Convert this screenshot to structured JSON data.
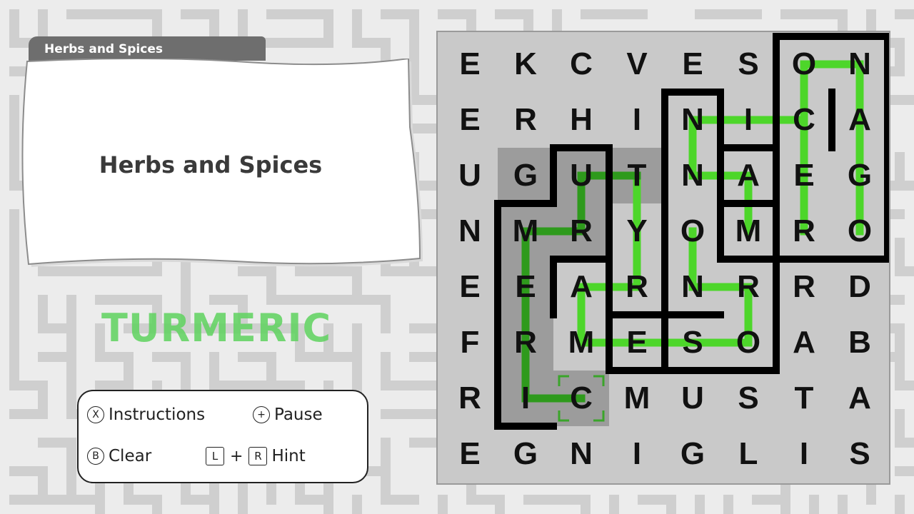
{
  "category_tab": "Herbs and Spices",
  "category_title": "Herbs and Spices",
  "found_word": "TURMERIC",
  "controls": {
    "instructions_button": "X",
    "instructions": "Instructions",
    "pause_button": "+",
    "pause": "Pause",
    "clear_button": "B",
    "clear": "Clear",
    "hint_key_l": "L",
    "hint_plus": "+",
    "hint_key_r": "R",
    "hint": "Hint"
  },
  "grid": [
    [
      "E",
      "K",
      "C",
      "V",
      "E",
      "S",
      "O",
      "N"
    ],
    [
      "E",
      "R",
      "H",
      "I",
      "N",
      "I",
      "C",
      "A"
    ],
    [
      "U",
      "G",
      "U",
      "T",
      "N",
      "A",
      "E",
      "G"
    ],
    [
      "N",
      "M",
      "R",
      "Y",
      "O",
      "M",
      "R",
      "O"
    ],
    [
      "E",
      "E",
      "A",
      "R",
      "N",
      "R",
      "R",
      "D"
    ],
    [
      "F",
      "R",
      "M",
      "E",
      "S",
      "O",
      "A",
      "B"
    ],
    [
      "R",
      "I",
      "C",
      "M",
      "U",
      "S",
      "T",
      "A"
    ],
    [
      "E",
      "G",
      "N",
      "I",
      "G",
      "L",
      "I",
      "S"
    ]
  ],
  "colors": {
    "found_path": "#4dd62a",
    "active_path": "#2e9a1c",
    "wall": "#000000",
    "board": "#c9c9c9",
    "selection_shade": "#9c9c9c"
  }
}
